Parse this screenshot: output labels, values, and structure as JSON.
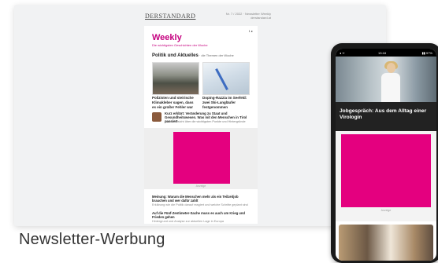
{
  "caption": "Newsletter-Werbung",
  "desktop": {
    "masthead": "DERSTANDARD",
    "meta_line1": "Nr. 7 / 2022 · Newsletter Weekly",
    "meta_line2": "derstandard.at",
    "issue_tag": "1 ▸",
    "title": "Weekly",
    "subtitle": "Die wichtigsten Geschichten der Woche",
    "section": "Politik und Aktuelles",
    "section_rest": " · die Themen der Woche",
    "story1": "Polizisten und steirische Klimakleber sagen, dass es ein großer Fehler war",
    "story2": "Doping-Razzia im Seefeld: zwei Ski-Langläufer festgenommen",
    "story3_title": "Kurz erklärt: Veränderung zu Staat und Gesundheitswesen. Was mit den Menschen in Tirol passiert",
    "story3_sub": "Eine Übersicht über die wichtigsten Punkte und Hintergründe",
    "ad_label": "Anzeige",
    "bottom1_title": "Meinung: Warum die Menschen mehr als ein Teilzeitjob brauchen und wer dafür zahlt",
    "bottom1_sub": "Erklärung wie die Politik darauf reagiert und welche Schritte geplant sind",
    "bottom2_title": "Auf die Fünf-Zentimeter-Sache muss es auch um Krieg und Frieden gehen",
    "bottom2_sub": "Hintergrund und Analyse zur aktuellen Lage in Europa"
  },
  "mobile": {
    "status_time": "13:18",
    "status_left": "◂ ᯤ",
    "status_right": "▮▮ 57%",
    "hero_title": "Jobgespräch: Aus dem Alltag einer Virologin",
    "ad_label": "Anzeige"
  },
  "colors": {
    "brand_pink": "#e4007f",
    "weekly_pink": "#c5007f"
  }
}
